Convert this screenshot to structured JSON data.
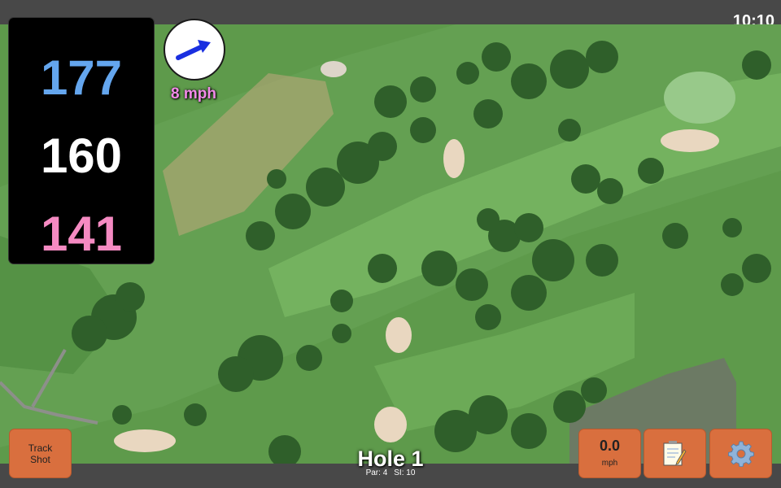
{
  "status_bar": {
    "time": "10:10"
  },
  "distances": {
    "back": "177",
    "middle": "160",
    "front": "141"
  },
  "wind": {
    "speed_label": "8 mph",
    "direction_icon": "wind-arrow-icon",
    "arrow_color": "#1a2fe0"
  },
  "buttons": {
    "track_shot_line1": "Track",
    "track_shot_line2": "Shot",
    "notes_icon": "notepad-icon",
    "settings_icon": "gear-icon"
  },
  "speed_readout": {
    "value": "0.0",
    "unit": "mph"
  },
  "hole": {
    "title": "Hole 1",
    "par": "Par: 4",
    "stroke_index": "SI: 10"
  },
  "colors": {
    "button": "#d96f3e",
    "back_distance": "#64a6ee",
    "front_distance": "#f58ac2",
    "wind_text": "#f28ae8"
  }
}
